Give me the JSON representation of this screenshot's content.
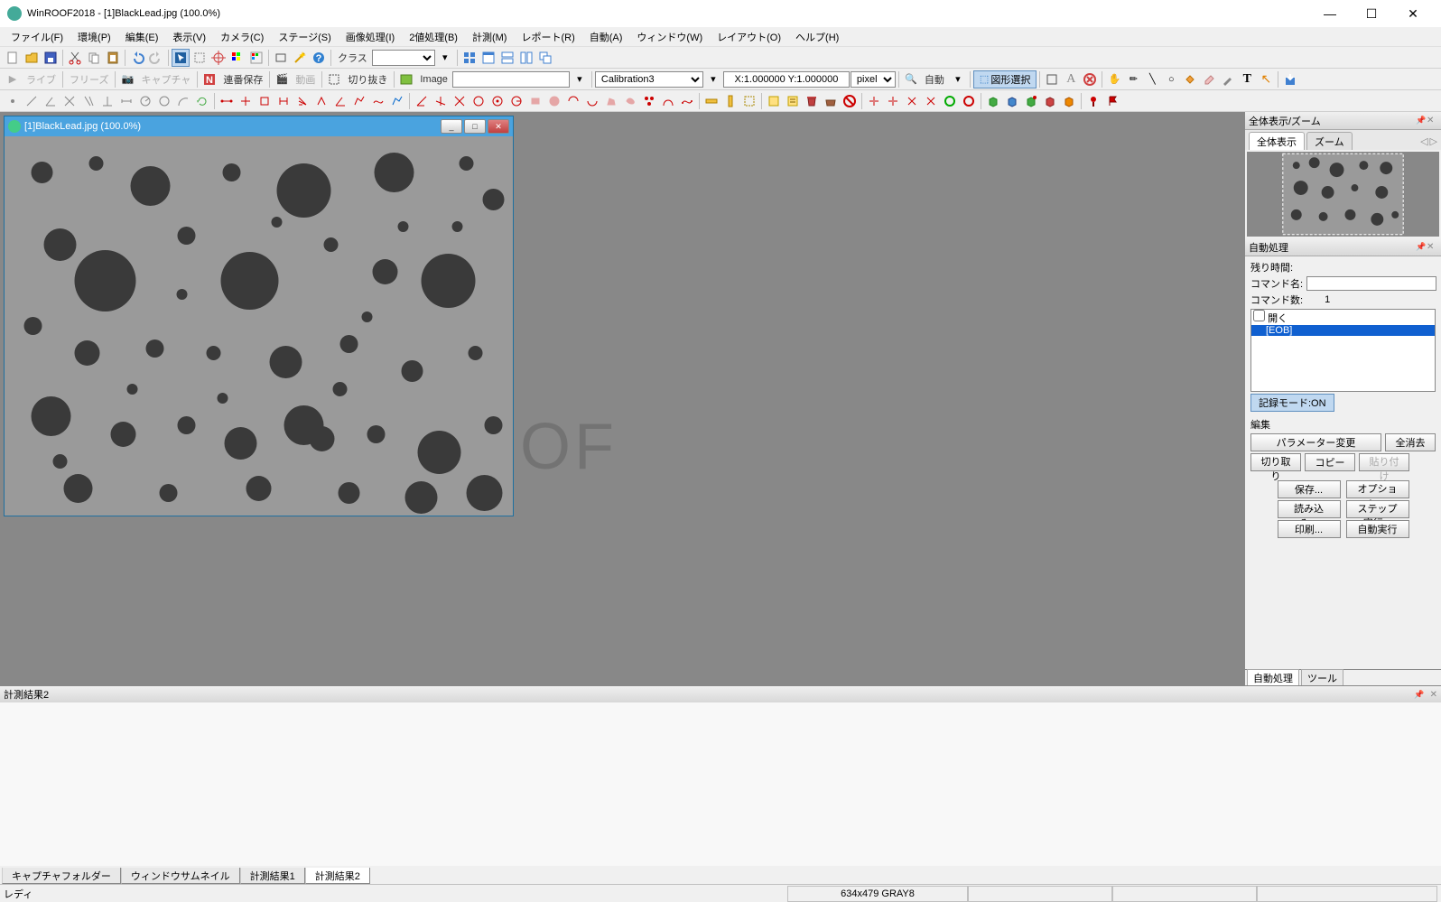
{
  "app": {
    "title": "WinROOF2018 - [1]BlackLead.jpg (100.0%)"
  },
  "menu": {
    "file": "ファイル(F)",
    "env": "環境(P)",
    "edit": "編集(E)",
    "view": "表示(V)",
    "camera": "カメラ(C)",
    "stage": "ステージ(S)",
    "improc": "画像処理(I)",
    "binary": "2値処理(B)",
    "measure": "計測(M)",
    "report": "レポート(R)",
    "auto": "自動(A)",
    "window": "ウィンドウ(W)",
    "layout": "レイアウト(O)",
    "help": "ヘルプ(H)"
  },
  "toolbar1": {
    "class_label": "クラス"
  },
  "toolbar2": {
    "live": "ライブ",
    "freeze": "フリーズ",
    "capture": "キャプチャ",
    "seqsave": "連番保存",
    "movie": "動画",
    "cut": "切り抜き",
    "image": "Image",
    "calibration": "Calibration3",
    "coords": "X:1.000000 Y:1.000000",
    "units": "pixel",
    "auto": "自動",
    "shape_select": "図形選択"
  },
  "doc": {
    "title": "[1]BlackLead.jpg (100.0%)"
  },
  "right": {
    "panel1_title": "全体表示/ズーム",
    "tab_full": "全体表示",
    "tab_zoom": "ズーム",
    "panel2_title": "自動処理",
    "remaining": "残り時間:",
    "cmdname": "コマンド名:",
    "cmdcount": "コマンド数:",
    "cmdcount_val": "1",
    "list_item1": "開く",
    "list_item2": "[EOB]",
    "rec_mode": "記録モード:ON",
    "edit_label": "編集",
    "param_change": "パラメーター変更",
    "clear_all": "全消去",
    "cut_btn": "切り取り",
    "copy_btn": "コピー",
    "paste_btn": "貼り付け",
    "save_btn": "保存...",
    "option_btn": "オプション...",
    "load_btn": "読み込み...",
    "step_btn": "ステップ実行...",
    "print_btn": "印刷...",
    "auto_exec": "自動実行",
    "bottom_tab1": "自動処理",
    "bottom_tab2": "ツール"
  },
  "results": {
    "title": "計測結果2",
    "tab1": "キャプチャフォルダー",
    "tab2": "ウィンドウサムネイル",
    "tab3": "計測結果1",
    "tab4": "計測結果2"
  },
  "status": {
    "ready": "レディ",
    "imginfo": "634x479 GRAY8"
  },
  "watermark": "ROOF"
}
